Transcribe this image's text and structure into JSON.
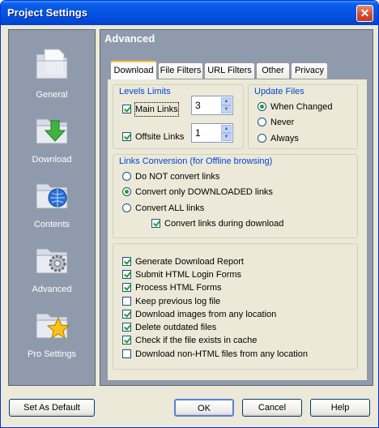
{
  "window": {
    "title": "Project Settings",
    "close_glyph": "✕"
  },
  "sidebar": {
    "items": [
      {
        "label": "General",
        "icon": "general-icon"
      },
      {
        "label": "Download",
        "icon": "download-icon"
      },
      {
        "label": "Contents",
        "icon": "contents-icon"
      },
      {
        "label": "Advanced",
        "icon": "advanced-icon"
      },
      {
        "label": "Pro Settings",
        "icon": "pro-settings-icon"
      }
    ]
  },
  "main": {
    "header": "Advanced",
    "tabs": [
      {
        "label": "Download",
        "active": true
      },
      {
        "label": "File Filters",
        "active": false
      },
      {
        "label": "URL Filters",
        "active": false
      },
      {
        "label": "Other",
        "active": false
      },
      {
        "label": "Privacy",
        "active": false
      }
    ]
  },
  "levels_limits": {
    "title": "Levels Limits",
    "main_links": {
      "label": "Main Links",
      "checked": true,
      "value": "3"
    },
    "offsite_links": {
      "label": "Offsite Links",
      "checked": true,
      "value": "1"
    }
  },
  "update_files": {
    "title": "Update Files",
    "options": [
      {
        "label": "When Changed",
        "selected": true
      },
      {
        "label": "Never",
        "selected": false
      },
      {
        "label": "Always",
        "selected": false
      }
    ]
  },
  "links_conversion": {
    "title": "Links Conversion (for Offline browsing)",
    "options": [
      {
        "label": "Do NOT convert links",
        "selected": false
      },
      {
        "label": "Convert only DOWNLOADED links",
        "selected": true
      },
      {
        "label": "Convert ALL links",
        "selected": false
      }
    ],
    "during_download": {
      "label": "Convert links during download",
      "checked": true
    }
  },
  "options": [
    {
      "label": "Generate Download Report",
      "checked": true
    },
    {
      "label": "Submit HTML Login Forms",
      "checked": true
    },
    {
      "label": "Process HTML Forms",
      "checked": true
    },
    {
      "label": "Keep previous log file",
      "checked": false
    },
    {
      "label": "Download images from any location",
      "checked": true
    },
    {
      "label": "Delete outdated files",
      "checked": true
    },
    {
      "label": "Check if the file exists in cache",
      "checked": true
    },
    {
      "label": "Download non-HTML files from any location",
      "checked": false
    }
  ],
  "buttons": {
    "set_default": "Set As Default",
    "ok": "OK",
    "cancel": "Cancel",
    "help": "Help"
  }
}
